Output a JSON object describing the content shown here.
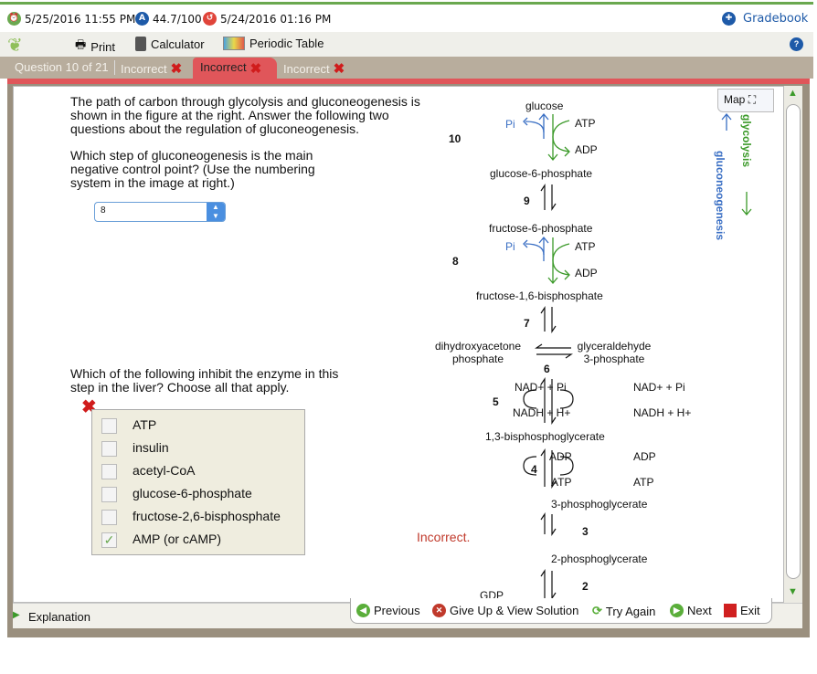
{
  "status": {
    "due": "5/25/2016 11:55 PM",
    "score": "44.7/100",
    "last": "5/24/2016 01:16 PM",
    "gradebook": "Gradebook"
  },
  "toolbar": {
    "print": "Print",
    "calculator": "Calculator",
    "periodic": "Periodic Table",
    "help": "?"
  },
  "tabs": {
    "question": "Question 10 of 21",
    "items": [
      "Incorrect",
      "Incorrect",
      "Incorrect"
    ]
  },
  "question": {
    "intro": "The path of carbon through glycolysis and gluconeogenesis is shown in the figure at the right. Answer the following two questions about the regulation of gluconeogenesis.",
    "q1": "Which step of gluconeogenesis is the main negative control point? (Use the numbering system in the image at right.)",
    "q1_value": "8",
    "q2": "Which of the following inhibit the enzyme in this step in the liver? Choose all that apply.",
    "options": [
      {
        "label": "ATP",
        "checked": false
      },
      {
        "label": "insulin",
        "checked": false
      },
      {
        "label": "acetyl-CoA",
        "checked": false
      },
      {
        "label": "glucose-6-phosphate",
        "checked": false
      },
      {
        "label": "fructose-2,6-bisphosphate",
        "checked": false
      },
      {
        "label": "AMP (or cAMP)",
        "checked": true
      }
    ],
    "feedback": "Incorrect."
  },
  "diagram": {
    "map": "Map",
    "glycolysis": "glycolysis",
    "gluconeogenesis": "gluconeogenesis",
    "compounds": {
      "glucose": "glucose",
      "g6p": "glucose-6-phosphate",
      "f6p": "fructose-6-phosphate",
      "f16bp": "fructose-1,6-bisphosphate",
      "dhap": "dihydroxyacetone phosphate",
      "gap": "glyceraldehyde 3-phosphate",
      "bpg": "1,3-bisphosphoglycerate",
      "pg3": "3-phosphoglycerate",
      "pg2": "2-phosphoglycerate",
      "gdp": "GDP"
    },
    "steps": [
      "10",
      "9",
      "8",
      "7",
      "6",
      "5",
      "4",
      "3",
      "2"
    ],
    "pi": "Pi",
    "atp": "ATP",
    "adp": "ADP",
    "nad": "NAD+ + Pi",
    "nadh": "NADH + H+"
  },
  "nav": {
    "previous": "Previous",
    "giveup": "Give Up & View Solution",
    "tryagain": "Try Again",
    "next": "Next",
    "exit": "Exit"
  },
  "explanation": "Explanation"
}
